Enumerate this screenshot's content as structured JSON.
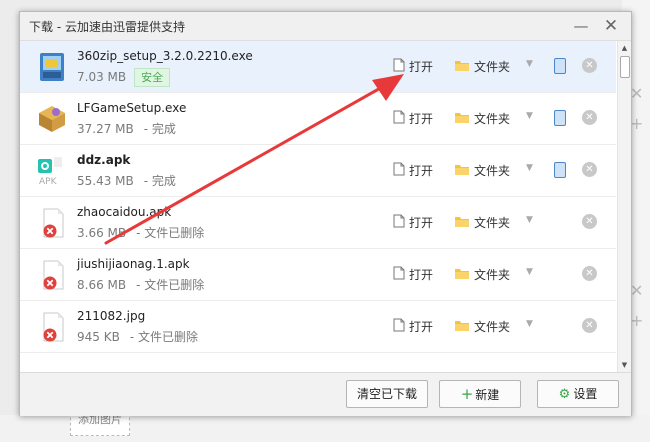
{
  "window": {
    "title": "下载 - 云加速由迅雷提供支持",
    "minimize_glyph": "—",
    "close_glyph": "✕"
  },
  "row_actions": {
    "open_label": "打开",
    "folder_label": "文件夹"
  },
  "files": [
    {
      "name": "360zip_setup_3.2.0.2210.exe",
      "size": "7.03 MB",
      "status": "",
      "badge": "安全",
      "icon": "installer-package-icon",
      "bold": false,
      "selected": true,
      "has_phone": true
    },
    {
      "name": "LFGameSetup.exe",
      "size": "37.27 MB",
      "status": "- 完成",
      "badge": "",
      "icon": "game-setup-icon",
      "bold": false,
      "selected": false,
      "has_phone": true
    },
    {
      "name": "ddz.apk",
      "size": "55.43 MB",
      "status": "- 完成",
      "badge": "",
      "icon": "apk-file-icon",
      "bold": true,
      "selected": false,
      "has_phone": true
    },
    {
      "name": "zhaocaidou.apk",
      "size": "3.66 MB",
      "status": "- 文件已删除",
      "badge": "",
      "icon": "deleted-file-icon",
      "bold": false,
      "selected": false,
      "has_phone": false
    },
    {
      "name": "jiushijiaonag.1.apk",
      "size": "8.66 MB",
      "status": "- 文件已删除",
      "badge": "",
      "icon": "deleted-file-icon",
      "bold": false,
      "selected": false,
      "has_phone": false
    },
    {
      "name": "211082.jpg",
      "size": "945 KB",
      "status": "- 文件已删除",
      "badge": "",
      "icon": "deleted-file-icon",
      "bold": false,
      "selected": false,
      "has_phone": false
    }
  ],
  "footer": {
    "clear_label": "清空已下载",
    "new_label": "新建",
    "settings_label": "设置"
  },
  "background": {
    "add_image_label": "添加图片"
  },
  "colors": {
    "selected_row": "#e9f2fc",
    "arrow": "#e8393a",
    "safe_badge": "#4aaa58",
    "folder": "#f5c242",
    "accent_green": "#3aa34c"
  }
}
